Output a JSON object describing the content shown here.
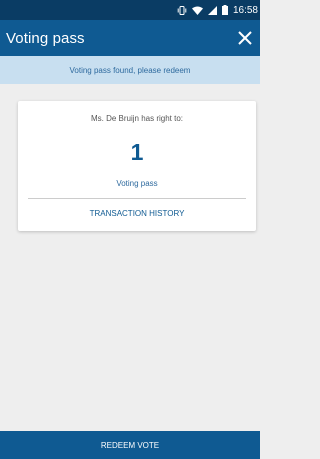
{
  "status_bar": {
    "time": "16:58",
    "icons": [
      "vibrate-icon",
      "wifi-icon",
      "signal-icon",
      "battery-icon"
    ]
  },
  "app_bar": {
    "title": "Voting pass",
    "close_icon": "close-icon"
  },
  "banner": {
    "text": "Voting pass found, please redeem"
  },
  "card": {
    "subtitle": "Ms. De  Bruijn has right to:",
    "count": "1",
    "item_label": "Voting pass",
    "history_link": "TRANSACTION HISTORY"
  },
  "footer": {
    "button_label": "REDEEM VOTE"
  },
  "colors": {
    "primary": "#0f5a92",
    "status_bar": "#0a3c64",
    "banner_bg": "#c8dff0",
    "background": "#eeeeee"
  }
}
